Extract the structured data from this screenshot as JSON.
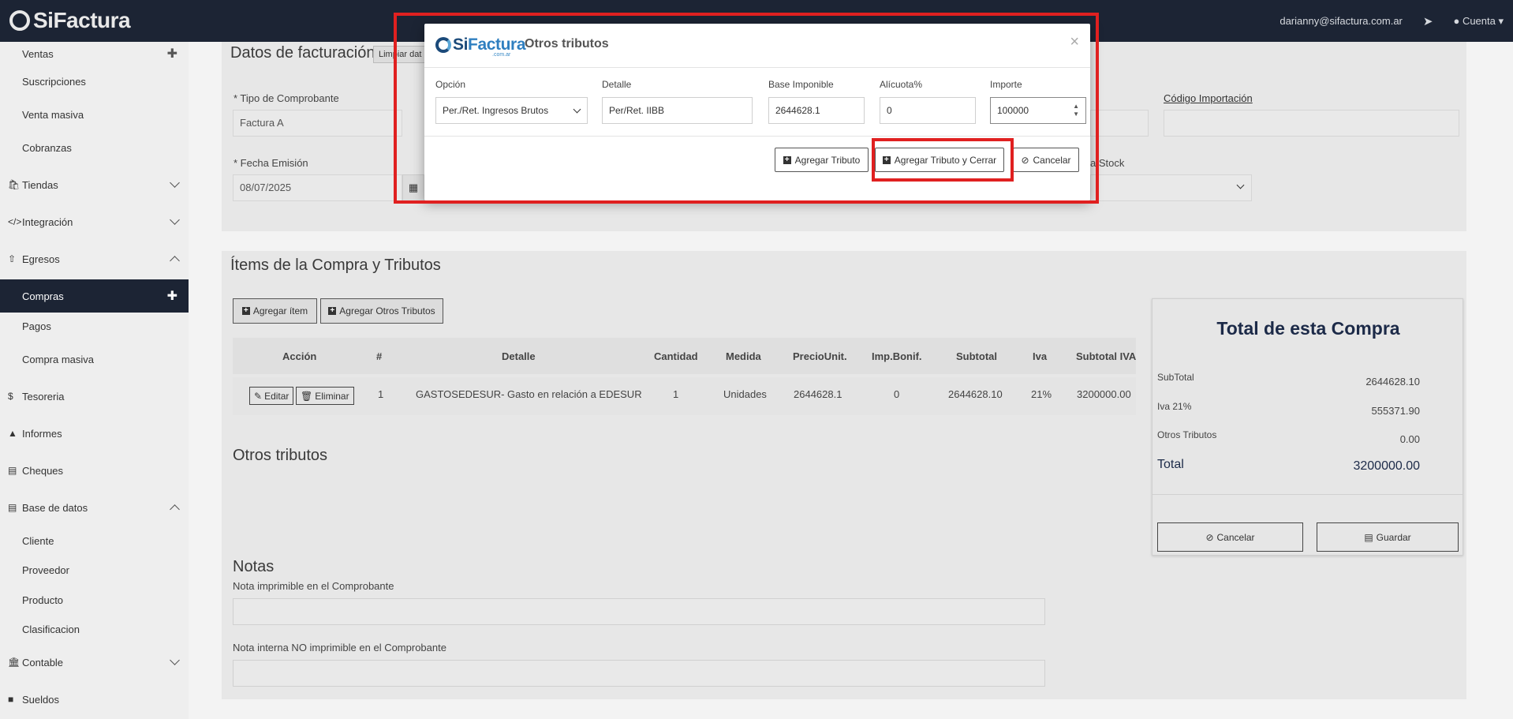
{
  "topbar": {
    "brand": "SiFactura",
    "user_email": "darianny@sifactura.com.ar",
    "account_label": "Cuenta"
  },
  "sidebar": {
    "items": [
      {
        "label": "Ventas",
        "kind": "sub",
        "icon": "",
        "suffix": "plus"
      },
      {
        "label": "Suscripciones",
        "kind": "sub",
        "icon": "",
        "suffix": ""
      },
      {
        "label": "Venta masiva",
        "kind": "sub",
        "icon": "",
        "suffix": ""
      },
      {
        "label": "Cobranzas",
        "kind": "sub",
        "icon": "",
        "suffix": ""
      },
      {
        "label": "Tiendas",
        "kind": "main",
        "icon": "shopping-bag-icon",
        "suffix": "chevron-down"
      },
      {
        "label": "Integración",
        "kind": "main",
        "icon": "code-icon",
        "suffix": "chevron-down"
      },
      {
        "label": "Egresos",
        "kind": "main",
        "icon": "upload-icon",
        "suffix": "chevron-up"
      },
      {
        "label": "Compras",
        "kind": "sub",
        "icon": "",
        "suffix": "plus",
        "active": true
      },
      {
        "label": "Pagos",
        "kind": "sub",
        "icon": "",
        "suffix": ""
      },
      {
        "label": "Compra masiva",
        "kind": "sub",
        "icon": "",
        "suffix": ""
      },
      {
        "label": "Tesoreria",
        "kind": "main",
        "icon": "dollar-icon",
        "suffix": ""
      },
      {
        "label": "Informes",
        "kind": "main",
        "icon": "area-chart-icon",
        "suffix": ""
      },
      {
        "label": "Cheques",
        "kind": "main",
        "icon": "credit-card-icon",
        "suffix": ""
      },
      {
        "label": "Base de datos",
        "kind": "main",
        "icon": "database-icon",
        "suffix": "chevron-up"
      },
      {
        "label": "Cliente",
        "kind": "sub",
        "icon": "",
        "suffix": ""
      },
      {
        "label": "Proveedor",
        "kind": "sub",
        "icon": "",
        "suffix": ""
      },
      {
        "label": "Producto",
        "kind": "sub",
        "icon": "",
        "suffix": ""
      },
      {
        "label": "Clasificacion",
        "kind": "sub",
        "icon": "",
        "suffix": ""
      },
      {
        "label": "Contable",
        "kind": "main",
        "icon": "bank-icon",
        "suffix": "chevron-down"
      },
      {
        "label": "Sueldos",
        "kind": "main",
        "icon": "book-icon",
        "suffix": ""
      }
    ]
  },
  "billing": {
    "title": "Datos de facturación",
    "clear_btn": "Limpiar dat",
    "tipo_label": "* Tipo de Comprobante",
    "tipo_value": "Factura A",
    "fecha_label": "* Fecha Emisión",
    "fecha_value": "08/07/2025",
    "codigo_label": "Código Importación",
    "stock_label": "a Stock"
  },
  "items": {
    "title": "Ítems de la Compra y Tributos",
    "add_item_btn": "Agregar ítem",
    "add_tributos_btn": "Agregar Otros Tributos",
    "headers": [
      "Acción",
      "#",
      "Detalle",
      "Cantidad",
      "Medida",
      "PrecioUnit.",
      "Imp.Bonif.",
      "Subtotal",
      "Iva",
      "Subtotal IVA"
    ],
    "rows": [
      {
        "edit": "Editar",
        "delete": "Eliminar",
        "num": "1",
        "detalle": "GASTOSEDESUR- Gasto en relación a EDESUR",
        "cantidad": "1",
        "medida": "Unidades",
        "precio": "2644628.1",
        "bonif": "0",
        "subtotal": "2644628.10",
        "iva": "21%",
        "subtotal_iva": "3200000.00"
      }
    ]
  },
  "otros": {
    "title": "Otros tributos"
  },
  "notas": {
    "title": "Notas",
    "nota_imprimible": "Nota imprimible en el Comprobante",
    "nota_interna": "Nota interna NO imprimible en el Comprobante"
  },
  "total": {
    "title": "Total de esta Compra",
    "subtotal_label": "SubTotal",
    "subtotal_value": "2644628.10",
    "iva_label": "Iva 21%",
    "iva_value": "555371.90",
    "otros_label": "Otros Tributos",
    "otros_value": "0.00",
    "total_label": "Total",
    "total_value": "3200000.00",
    "cancel_btn": "Cancelar",
    "save_btn": "Guardar"
  },
  "modal": {
    "brand_si": "Si",
    "brand_factura": "Factura",
    "brand_tld": ".com.ar",
    "title": "Otros tributos",
    "close": "×",
    "opcion_label": "Opción",
    "opcion_value": "Per./Ret. Ingresos Brutos",
    "detalle_label": "Detalle",
    "detalle_value": "Per/Ret. IIBB",
    "base_label": "Base Imponible",
    "base_value": "2644628.1",
    "alicuota_label": "Alícuota%",
    "alicuota_value": "0",
    "importe_label": "Importe",
    "importe_value": "100000",
    "btn_agregar": "Agregar Tributo",
    "btn_agregar_cerrar": "Agregar Tributo y Cerrar",
    "btn_cancelar": "Cancelar"
  },
  "colors": {
    "navy": "#1c2434",
    "highlight": "#e02020",
    "brand_blue": "#1b4a7a"
  }
}
